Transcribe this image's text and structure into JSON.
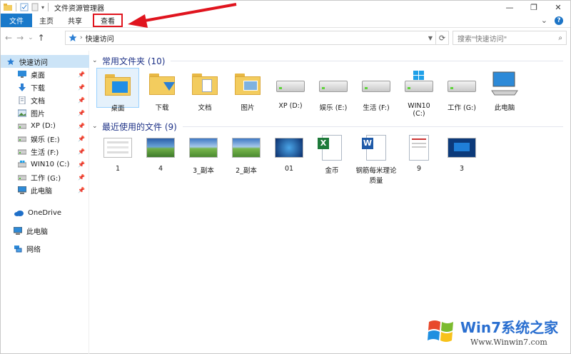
{
  "titlebar": {
    "title": "文件资源管理器",
    "min": "—",
    "max": "❐",
    "close": "✕"
  },
  "ribbon": {
    "tabs": [
      "文件",
      "主页",
      "共享",
      "查看"
    ],
    "collapse": "⌄",
    "help": "?"
  },
  "address": {
    "back": "←",
    "forward": "→",
    "recent": "⌄",
    "up": "↑",
    "path": "快速访问",
    "refresh": "⟳",
    "search_placeholder": "搜索\"快速访问\"",
    "search_icon": "⌕"
  },
  "sidebar": {
    "quick_access": "快速访问",
    "items": [
      {
        "label": "桌面",
        "icon": "desktop-icon",
        "pinned": true
      },
      {
        "label": "下载",
        "icon": "download-icon",
        "pinned": true
      },
      {
        "label": "文档",
        "icon": "documents-icon",
        "pinned": true
      },
      {
        "label": "图片",
        "icon": "pictures-icon",
        "pinned": true
      },
      {
        "label": "XP (D:)",
        "icon": "drive-icon",
        "pinned": true
      },
      {
        "label": "娱乐 (E:)",
        "icon": "drive-icon",
        "pinned": true
      },
      {
        "label": "生活 (F:)",
        "icon": "drive-icon",
        "pinned": true
      },
      {
        "label": "WIN10 (C:)",
        "icon": "windows-drive-icon",
        "pinned": true
      },
      {
        "label": "工作 (G:)",
        "icon": "drive-icon",
        "pinned": true
      },
      {
        "label": "此电脑",
        "icon": "computer-icon",
        "pinned": true
      }
    ],
    "onedrive": "OneDrive",
    "thispc": "此电脑",
    "network": "网络"
  },
  "frequent": {
    "title": "常用文件夹 (10)",
    "items": [
      "桌面",
      "下载",
      "文档",
      "图片",
      "XP (D:)",
      "娱乐 (E:)",
      "生活 (F:)",
      "WIN10\n(C:)",
      "工作 (G:)",
      "此电脑"
    ]
  },
  "recent": {
    "title": "最近使用的文件 (9)",
    "items": [
      "1",
      "4",
      "3_副本",
      "2_副本",
      "01",
      "金币",
      "钢筋每米理论质量",
      "9",
      "3"
    ]
  },
  "watermark": {
    "text": "Win7系统之家",
    "url": "Www.Winwin7.com"
  },
  "colors": {
    "accent": "#1979ca",
    "highlight": "#e0141e",
    "group_title": "#1e3287"
  }
}
